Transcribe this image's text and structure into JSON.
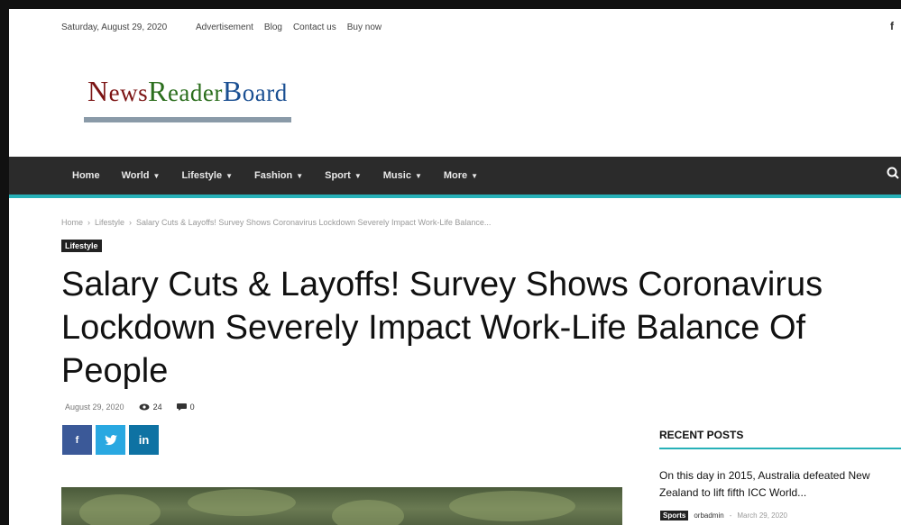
{
  "topbar": {
    "date": "Saturday, August 29, 2020",
    "links": [
      "Advertisement",
      "Blog",
      "Contact us",
      "Buy now"
    ],
    "facebook_icon": "f"
  },
  "logo": {
    "part1_cap": "N",
    "part1_rest": "ews",
    "part2_cap": "R",
    "part2_rest": "eader",
    "part3_cap": "B",
    "part3_rest": "oard"
  },
  "nav": {
    "items": [
      {
        "label": "Home",
        "dropdown": false
      },
      {
        "label": "World",
        "dropdown": true
      },
      {
        "label": "Lifestyle",
        "dropdown": true
      },
      {
        "label": "Fashion",
        "dropdown": true
      },
      {
        "label": "Sport",
        "dropdown": true
      },
      {
        "label": "Music",
        "dropdown": true
      },
      {
        "label": "More",
        "dropdown": true
      }
    ],
    "accent_color": "#27b1b8",
    "bar_color": "#2b2b2b"
  },
  "breadcrumb": {
    "home": "Home",
    "category": "Lifestyle",
    "current": "Salary Cuts & Layoffs! Survey Shows Coronavirus Lockdown Severely Impact Work-Life Balance..."
  },
  "article": {
    "category_tag": "Lifestyle",
    "title": "Salary Cuts & Layoffs! Survey Shows Coronavirus Lockdown Severely Impact Work-Life Balance Of People",
    "date": "August 29, 2020",
    "views": "24",
    "comments": "0"
  },
  "share": {
    "facebook": "f",
    "twitter": "t",
    "linkedin": "in"
  },
  "sidebar": {
    "heading": "RECENT POSTS",
    "post": {
      "title": "On this day in 2015, Australia defeated New Zealand to lift fifth ICC World...",
      "category": "Sports",
      "author": "orbadmin",
      "date": "March 29, 2020"
    }
  }
}
